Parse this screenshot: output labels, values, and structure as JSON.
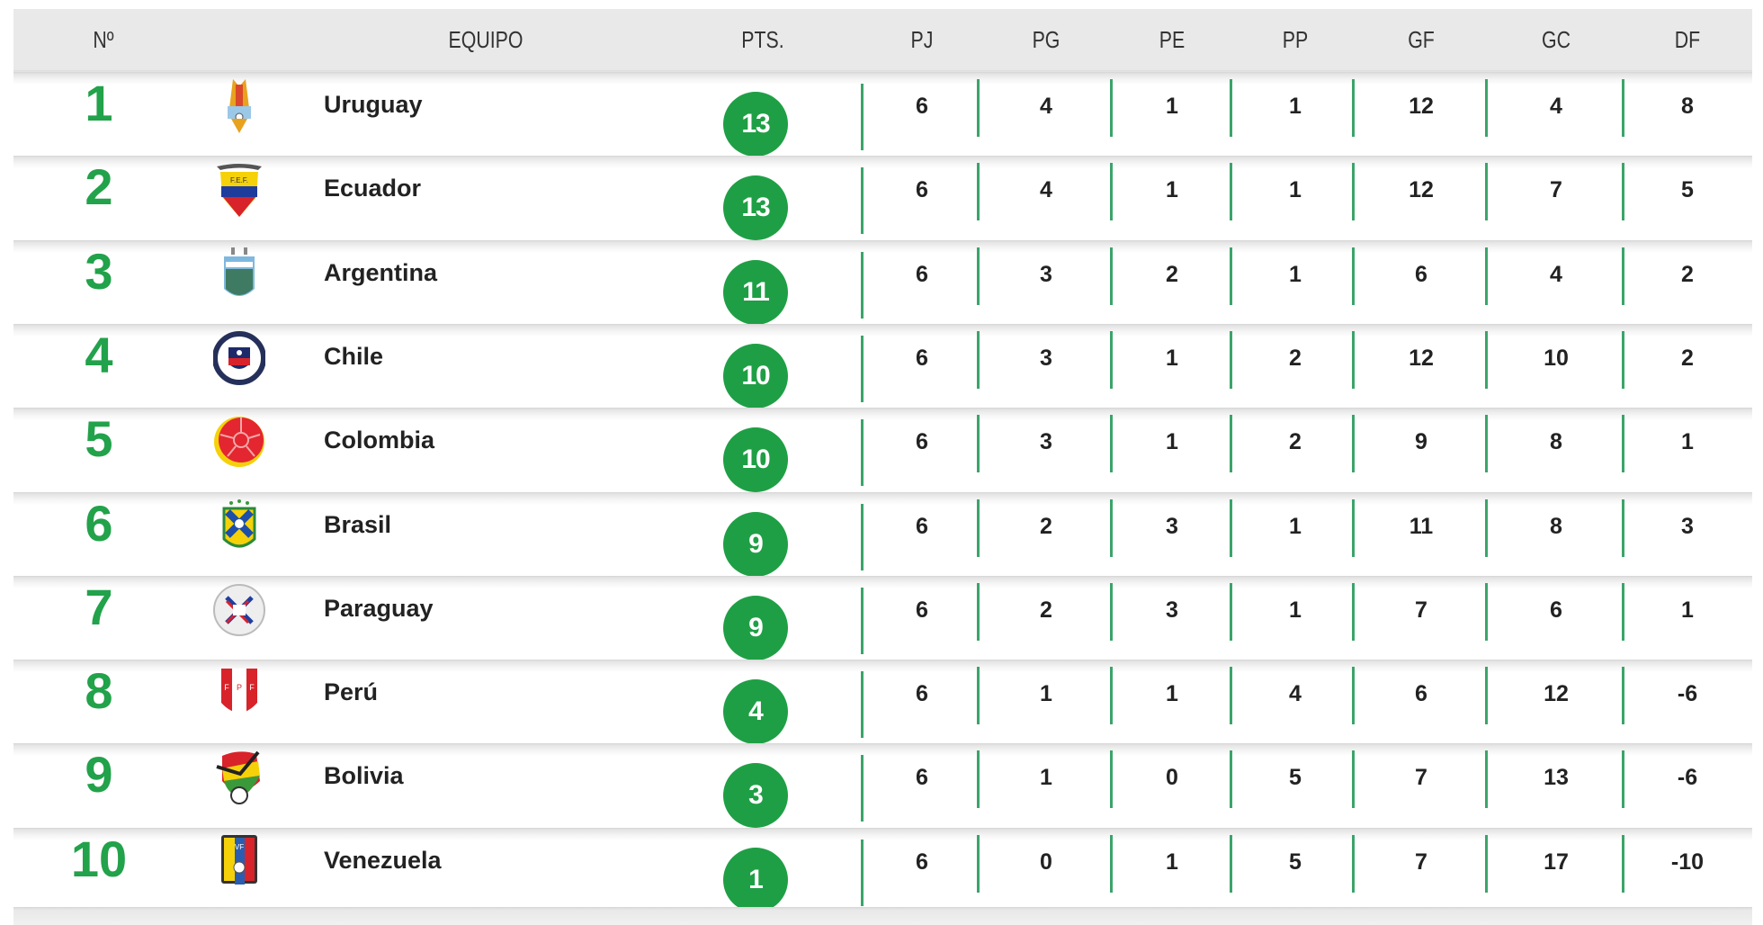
{
  "header": {
    "rank": "Nº",
    "team": "EQUIPO",
    "pts": "PTS.",
    "pj": "PJ",
    "pg": "PG",
    "pe": "PE",
    "pp": "PP",
    "gf": "GF",
    "gc": "GC",
    "df": "DF"
  },
  "colors": {
    "accent_green": "#1f9f45",
    "rank_green": "#22a24a",
    "header_bg": "#e9e9e9",
    "separator_green": "#3ba46a"
  },
  "rows": [
    {
      "rank": "1",
      "team": "Uruguay",
      "crest": "uruguay-crest-icon",
      "pts": "13",
      "pj": "6",
      "pg": "4",
      "pe": "1",
      "pp": "1",
      "gf": "12",
      "gc": "4",
      "df": "8"
    },
    {
      "rank": "2",
      "team": "Ecuador",
      "crest": "ecuador-crest-icon",
      "pts": "13",
      "pj": "6",
      "pg": "4",
      "pe": "1",
      "pp": "1",
      "gf": "12",
      "gc": "7",
      "df": "5"
    },
    {
      "rank": "3",
      "team": "Argentina",
      "crest": "argentina-crest-icon",
      "pts": "11",
      "pj": "6",
      "pg": "3",
      "pe": "2",
      "pp": "1",
      "gf": "6",
      "gc": "4",
      "df": "2"
    },
    {
      "rank": "4",
      "team": "Chile",
      "crest": "chile-crest-icon",
      "pts": "10",
      "pj": "6",
      "pg": "3",
      "pe": "1",
      "pp": "2",
      "gf": "12",
      "gc": "10",
      "df": "2"
    },
    {
      "rank": "5",
      "team": "Colombia",
      "crest": "colombia-crest-icon",
      "pts": "10",
      "pj": "6",
      "pg": "3",
      "pe": "1",
      "pp": "2",
      "gf": "9",
      "gc": "8",
      "df": "1"
    },
    {
      "rank": "6",
      "team": "Brasil",
      "crest": "brasil-crest-icon",
      "pts": "9",
      "pj": "6",
      "pg": "2",
      "pe": "3",
      "pp": "1",
      "gf": "11",
      "gc": "8",
      "df": "3"
    },
    {
      "rank": "7",
      "team": "Paraguay",
      "crest": "paraguay-crest-icon",
      "pts": "9",
      "pj": "6",
      "pg": "2",
      "pe": "3",
      "pp": "1",
      "gf": "7",
      "gc": "6",
      "df": "1"
    },
    {
      "rank": "8",
      "team": "Perú",
      "crest": "peru-crest-icon",
      "pts": "4",
      "pj": "6",
      "pg": "1",
      "pe": "1",
      "pp": "4",
      "gf": "6",
      "gc": "12",
      "df": "-6"
    },
    {
      "rank": "9",
      "team": "Bolivia",
      "crest": "bolivia-crest-icon",
      "pts": "3",
      "pj": "6",
      "pg": "1",
      "pe": "0",
      "pp": "5",
      "gf": "7",
      "gc": "13",
      "df": "-6"
    },
    {
      "rank": "10",
      "team": "Venezuela",
      "crest": "venezuela-crest-icon",
      "pts": "1",
      "pj": "6",
      "pg": "0",
      "pe": "1",
      "pp": "5",
      "gf": "7",
      "gc": "17",
      "df": "-10"
    }
  ]
}
